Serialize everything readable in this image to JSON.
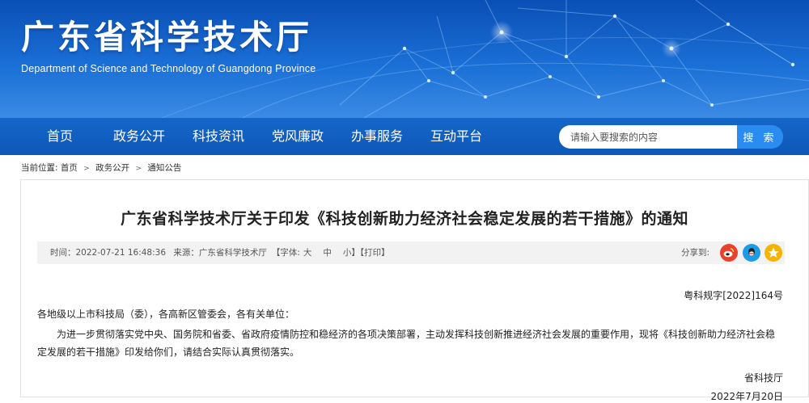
{
  "header": {
    "title": "广东省科学技术厅",
    "subtitle": "Department of Science and Technology of Guangdong Province"
  },
  "nav": {
    "items": [
      "首页",
      "政务公开",
      "科技资讯",
      "党风廉政",
      "办事服务",
      "互动平台"
    ],
    "search_placeholder": "请输入要搜索的内容",
    "search_button": "搜 索"
  },
  "breadcrumb": {
    "label": "当前位置:",
    "items": [
      "首页",
      "政务公开",
      "通知公告"
    ]
  },
  "article": {
    "title": "广东省科学技术厅关于印发《科技创新助力经济社会稳定发展的若干措施》的通知",
    "meta": {
      "time": "时间：2022-07-21 16:48:36",
      "source": "来源：广东省科学技术厅",
      "font_label": "【字体:",
      "font_large": "大",
      "font_medium": "中",
      "font_small": "小",
      "font_close": "】",
      "print": "【打印】",
      "share_label": "分享到:"
    },
    "doc_number": "粤科规字[2022]164号",
    "salutation": "各地级以上市科技局（委），各高新区管委会，各有关单位：",
    "paragraph": "为进一步贯彻落实党中央、国务院和省委、省政府疫情防控和稳经济的各项决策部署，主动发挥科技创新推进经济社会发展的重要作用，现将《科技创新助力经济社会稳定发展的若干措施》印发给你们，请结合实际认真贯彻落实。",
    "signature": "省科技厅",
    "date": "2022年7月20日"
  },
  "share_icons": [
    {
      "name": "weibo-icon",
      "color": "#e8412c"
    },
    {
      "name": "qq-icon",
      "color": "#1c9ce6"
    },
    {
      "name": "qzone-icon",
      "color": "#f5b400"
    }
  ]
}
